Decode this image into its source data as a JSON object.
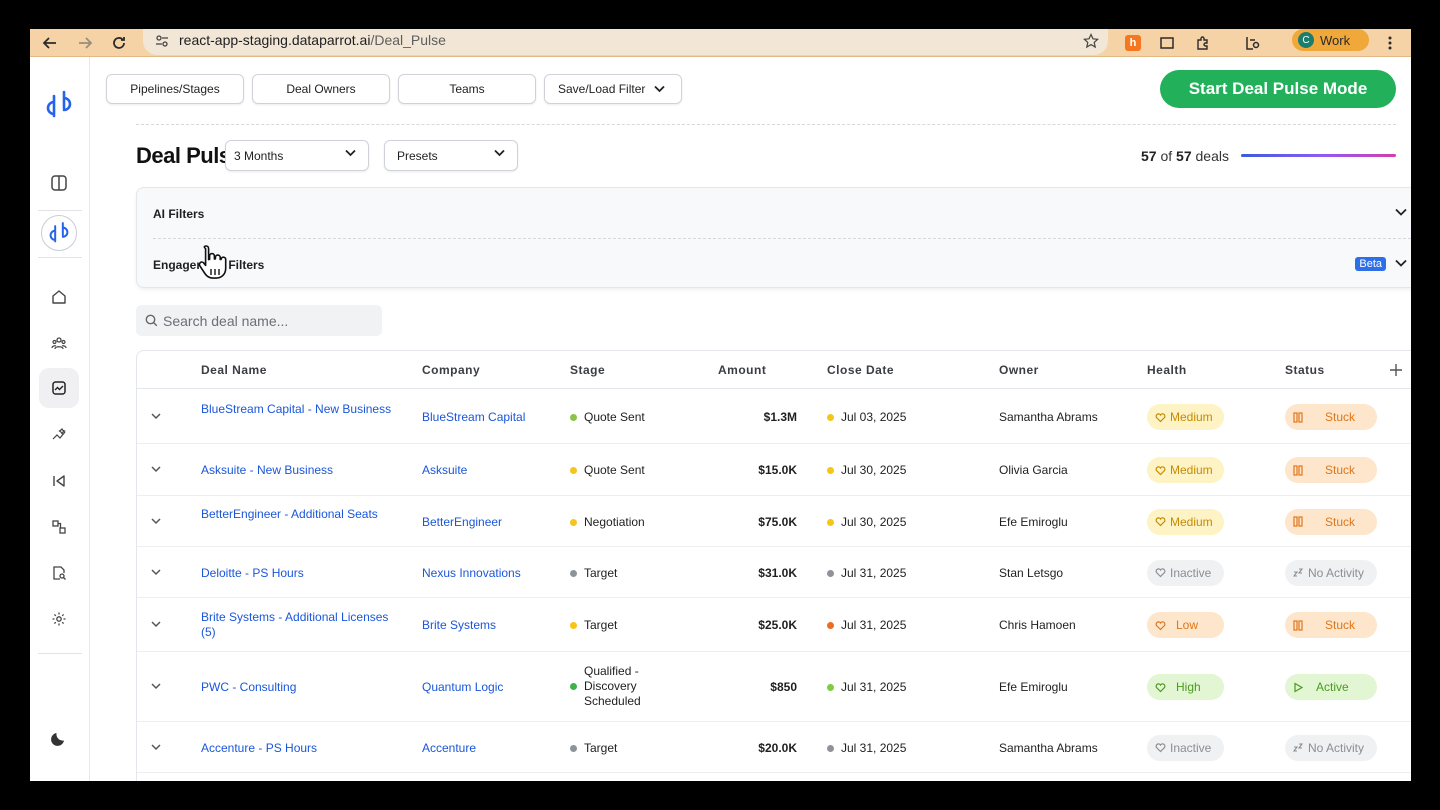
{
  "browser": {
    "url_host": "react-app-staging.dataparrot.ai",
    "url_path": "/Deal_Pulse",
    "profile_initial": "C",
    "profile_name": "Work"
  },
  "toolbar": {
    "pipelines_label": "Pipelines/Stages",
    "owners_label": "Deal Owners",
    "teams_label": "Teams",
    "saveload_label": "Save/Load Filter",
    "start_label": "Start Deal Pulse Mode"
  },
  "header": {
    "title": "Deal Pulse",
    "period": "3 Months",
    "presets": "Presets",
    "count_shown": "57",
    "count_of": "of",
    "count_total": "57",
    "count_suffix": "deals"
  },
  "filters": {
    "ai_label": "AI Filters",
    "engagement_label": "Engagement Filters",
    "beta": "Beta"
  },
  "search": {
    "placeholder": "Search deal name..."
  },
  "table": {
    "columns": [
      "Deal Name",
      "Company",
      "Stage",
      "Amount",
      "Close Date",
      "Owner",
      "Health",
      "Status"
    ],
    "rows": [
      {
        "deal": "BlueStream Capital - New Business",
        "company": "BlueStream Capital",
        "stage": "Quote Sent",
        "stage_color": "#8bc34a",
        "amount": "$1.3M",
        "close": "Jul 03, 2025",
        "close_color": "#f5c518",
        "owner": "Samantha Abrams",
        "health": "Medium",
        "status": "Stuck"
      },
      {
        "deal": "Asksuite - New Business",
        "company": "Asksuite",
        "stage": "Quote Sent",
        "stage_color": "#f5c518",
        "amount": "$15.0K",
        "close": "Jul 30, 2025",
        "close_color": "#f5c518",
        "owner": "Olivia Garcia",
        "health": "Medium",
        "status": "Stuck"
      },
      {
        "deal": "BetterEngineer - Additional Seats",
        "company": "BetterEngineer",
        "stage": "Negotiation",
        "stage_color": "#f5c518",
        "amount": "$75.0K",
        "close": "Jul 30, 2025",
        "close_color": "#f5c518",
        "owner": "Efe Emiroglu",
        "health": "Medium",
        "status": "Stuck"
      },
      {
        "deal": "Deloitte - PS Hours",
        "company": "Nexus Innovations",
        "stage": "Target",
        "stage_color": "#8e9299",
        "amount": "$31.0K",
        "close": "Jul 31, 2025",
        "close_color": "#8e9299",
        "owner": "Stan Letsgo",
        "health": "Inactive",
        "status": "No Activity"
      },
      {
        "deal": "Brite Systems - Additional Licenses (5)",
        "company": "Brite Systems",
        "stage": "Target",
        "stage_color": "#f5c518",
        "amount": "$25.0K",
        "close": "Jul 31, 2025",
        "close_color": "#f06a1f",
        "owner": "Chris Hamoen",
        "health": "Low",
        "status": "Stuck"
      },
      {
        "deal": "PWC - Consulting",
        "company": "Quantum Logic",
        "stage": "Qualified - Discovery Scheduled",
        "stage_color": "#3cb44b",
        "amount": "$850",
        "close": "Jul 31, 2025",
        "close_color": "#7ccf3a",
        "owner": "Efe Emiroglu",
        "health": "High",
        "status": "Active"
      },
      {
        "deal": "Accenture - PS Hours",
        "company": "Accenture",
        "stage": "Target",
        "stage_color": "#8e9299",
        "amount": "$20.0K",
        "close": "Jul 31, 2025",
        "close_color": "#8e9299",
        "owner": "Samantha Abrams",
        "health": "Inactive",
        "status": "No Activity"
      }
    ]
  },
  "colors": {
    "accent": "#1a56db",
    "start_button": "#22b15a",
    "medium_bg": "#fdf3c4",
    "medium_fg": "#c88a00",
    "low_bg": "#fde6cc",
    "low_fg": "#e0761a",
    "high_bg": "#e2f6d3",
    "high_fg": "#4c9a1e",
    "inactive_bg": "#f0f1f3",
    "inactive_fg": "#8a8e95",
    "stuck_bg": "#fde6cc",
    "stuck_fg": "#e0761a",
    "active_bg": "#e2f6d3",
    "active_fg": "#4c9a1e"
  }
}
